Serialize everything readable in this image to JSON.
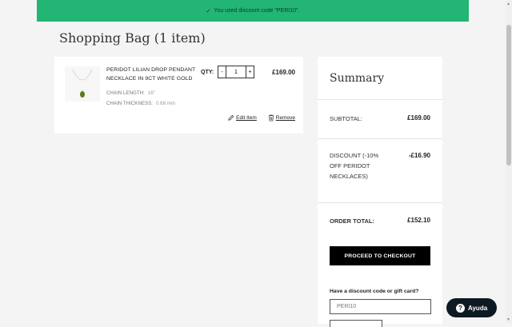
{
  "banner": {
    "check": "✓",
    "message": "You used discount code \"PERI10\"."
  },
  "page": {
    "title": "Shopping Bag (1 item)"
  },
  "item": {
    "name": "PERIDOT LILIAN DROP PENDANT NECKLACE IN 9CT WHITE GOLD",
    "attrs": [
      {
        "label": "CHAIN LENGTH:",
        "value": "16\""
      },
      {
        "label": "CHAIN THICKNESS:",
        "value": "0.68 mm"
      }
    ],
    "qty_label": "QTY:",
    "qty_value": "1",
    "minus": "-",
    "plus": "+",
    "price": "£169.00",
    "edit_label": "Edit Item",
    "remove_label": "Remove"
  },
  "summary": {
    "title": "Summary",
    "subtotal_label": "SUBTOTAL:",
    "subtotal_value": "£169.00",
    "discount_label": "DISCOUNT (-10% OFF PERIDOT NECKLACES)",
    "discount_value": "-£16.90",
    "total_label": "ORDER TOTAL:",
    "total_value": "£152.10",
    "checkout_label": "PROCEED TO CHECKOUT",
    "discount_prompt": "Have a discount code or gift card?",
    "discount_code": "PERI10"
  },
  "help": {
    "label": "Ayuda",
    "icon": "?"
  },
  "colors": {
    "banner": "#22b573",
    "button": "#000000",
    "help": "#0e1a22"
  }
}
